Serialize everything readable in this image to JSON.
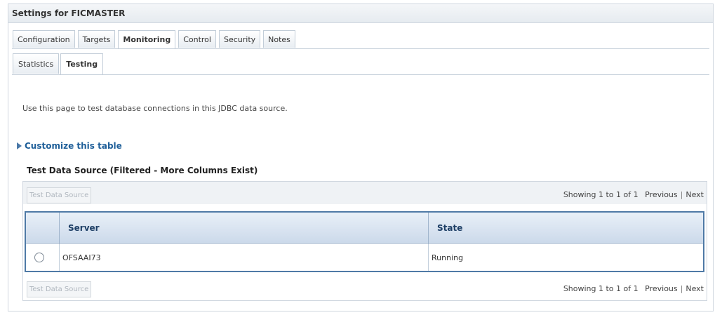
{
  "panel": {
    "title": "Settings for FICMASTER"
  },
  "tabs": [
    {
      "label": "Configuration",
      "active": false
    },
    {
      "label": "Targets",
      "active": false
    },
    {
      "label": "Monitoring",
      "active": true
    },
    {
      "label": "Control",
      "active": false
    },
    {
      "label": "Security",
      "active": false
    },
    {
      "label": "Notes",
      "active": false
    }
  ],
  "subtabs": [
    {
      "label": "Statistics",
      "active": false
    },
    {
      "label": "Testing",
      "active": true
    }
  ],
  "intro_text": "Use this page to test database connections in this JDBC data source.",
  "customize_link": "Customize this table",
  "table": {
    "title": "Test Data Source (Filtered - More Columns Exist)",
    "button_label": "Test Data Source",
    "pager": {
      "showing": "Showing 1 to 1 of 1",
      "previous": "Previous",
      "next": "Next"
    },
    "columns": [
      "Server",
      "State"
    ],
    "rows": [
      {
        "server": "OFSAAI73",
        "state": "Running",
        "selected": false
      }
    ]
  },
  "colors": {
    "accent": "#1f5f99",
    "table_border": "#4f7aa6",
    "header_bg": "#cbd9ea"
  }
}
